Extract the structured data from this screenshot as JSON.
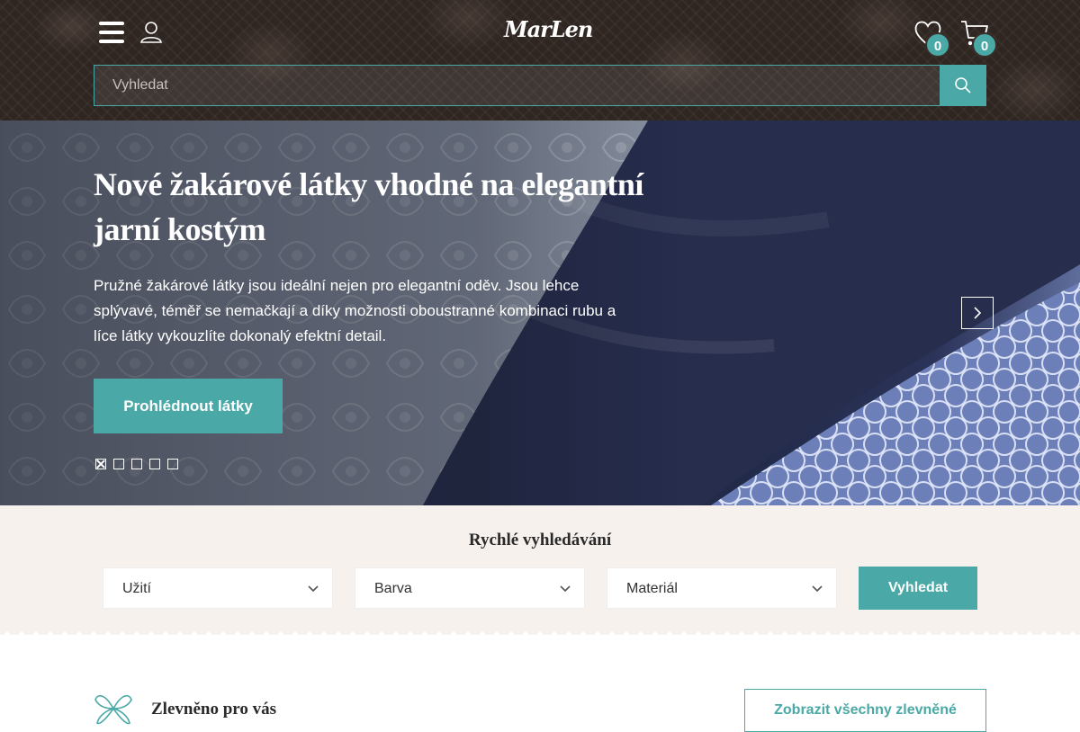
{
  "header": {
    "logo_text": "MarLen",
    "search_placeholder": "Vyhledat",
    "wishlist_count": "0",
    "cart_count": "0"
  },
  "hero": {
    "title": "Nové žakárové látky vhodné na elegantní jarní kostým",
    "text": "Pružné žakárové látky jsou ideální nejen pro elegantní oděv. Jsou lehce splývavé, téměř se nemačkají a díky možnosti oboustranné kombinaci rubu a líce látky vykouzlíte dokonalý efektní detail.",
    "cta_label": "Prohlédnout látky",
    "slides": 5,
    "active_slide": 1
  },
  "quick_search": {
    "title": "Rychlé vyhledávání",
    "filters": [
      "Užití",
      "Barva",
      "Materiál"
    ],
    "button_label": "Vyhledat"
  },
  "discounts": {
    "title": "Zlevněno pro vás",
    "button_label": "Zobrazit všechny zlevněné"
  },
  "colors": {
    "accent": "#4aa9a6",
    "header_bg": "#2f2622",
    "quick_bg": "#f7f1ee"
  },
  "icons": [
    "menu-icon",
    "user-icon",
    "heart-icon",
    "cart-icon",
    "search-icon",
    "chevron-right-icon",
    "chevron-down-icon",
    "flower-icon"
  ]
}
